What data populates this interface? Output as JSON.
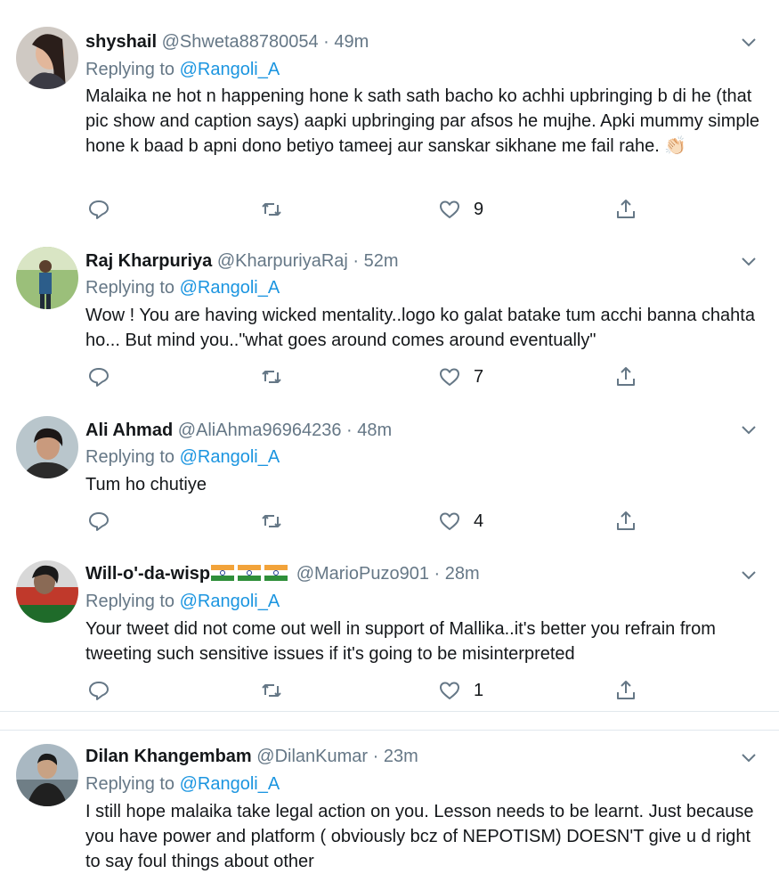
{
  "tweets": [
    {
      "name": "shyshail",
      "handle": "@Shweta88780054",
      "time": "49m",
      "replying_prefix": "Replying to",
      "replying_to": "@Rangoli_A",
      "text": "Malaika ne hot n happening hone k sath sath bacho ko achhi upbringing b di he (that pic show and caption says) aapki upbringing par afsos he mujhe. Apki mummy simple hone k baad b apni dono betiyo  tameej aur sanskar sikhane me fail rahe. 👏🏻",
      "likes": "9"
    },
    {
      "name": "Raj Kharpuriya",
      "handle": "@KharpuriyaRaj",
      "time": "52m",
      "replying_prefix": "Replying to",
      "replying_to": "@Rangoli_A",
      "text": "Wow ! You are having wicked mentality..logo ko galat batake tum acchi banna chahta ho... But mind you..\"what goes around comes around eventually\"",
      "likes": "7"
    },
    {
      "name": "Ali Ahmad",
      "handle": "@AliAhma96964236",
      "time": "48m",
      "replying_prefix": "Replying to",
      "replying_to": "@Rangoli_A",
      "text": "Tum ho chutiye",
      "likes": "4"
    },
    {
      "name": "Will-o'-da-wisp",
      "handle": "@MarioPuzo901",
      "time": "28m",
      "replying_prefix": "Replying to",
      "replying_to": "@Rangoli_A",
      "text": "Your tweet did not come out well in support of Mallika..it's better you refrain from tweeting such sensitive issues if it's going to be misinterpreted",
      "likes": "1"
    },
    {
      "name": "Dilan Khangembam",
      "handle": "@DilanKumar",
      "time": "23m",
      "replying_prefix": "Replying to",
      "replying_to": "@Rangoli_A",
      "text": "I still hope malaika take legal action on you. Lesson needs to be learnt. Just because you have power and platform ( obviously bcz of NEPOTISM) DOESN'T give u d right to say foul things about other"
    }
  ],
  "separator": "·",
  "icons": {
    "reply": "reply-icon",
    "retweet": "retweet-icon",
    "like": "heart-icon",
    "share": "share-icon",
    "menu": "chevron-down-icon"
  },
  "colors": {
    "link": "#1b95e0",
    "muted": "#657786",
    "text": "#14171a",
    "border": "#e1e8ed"
  }
}
